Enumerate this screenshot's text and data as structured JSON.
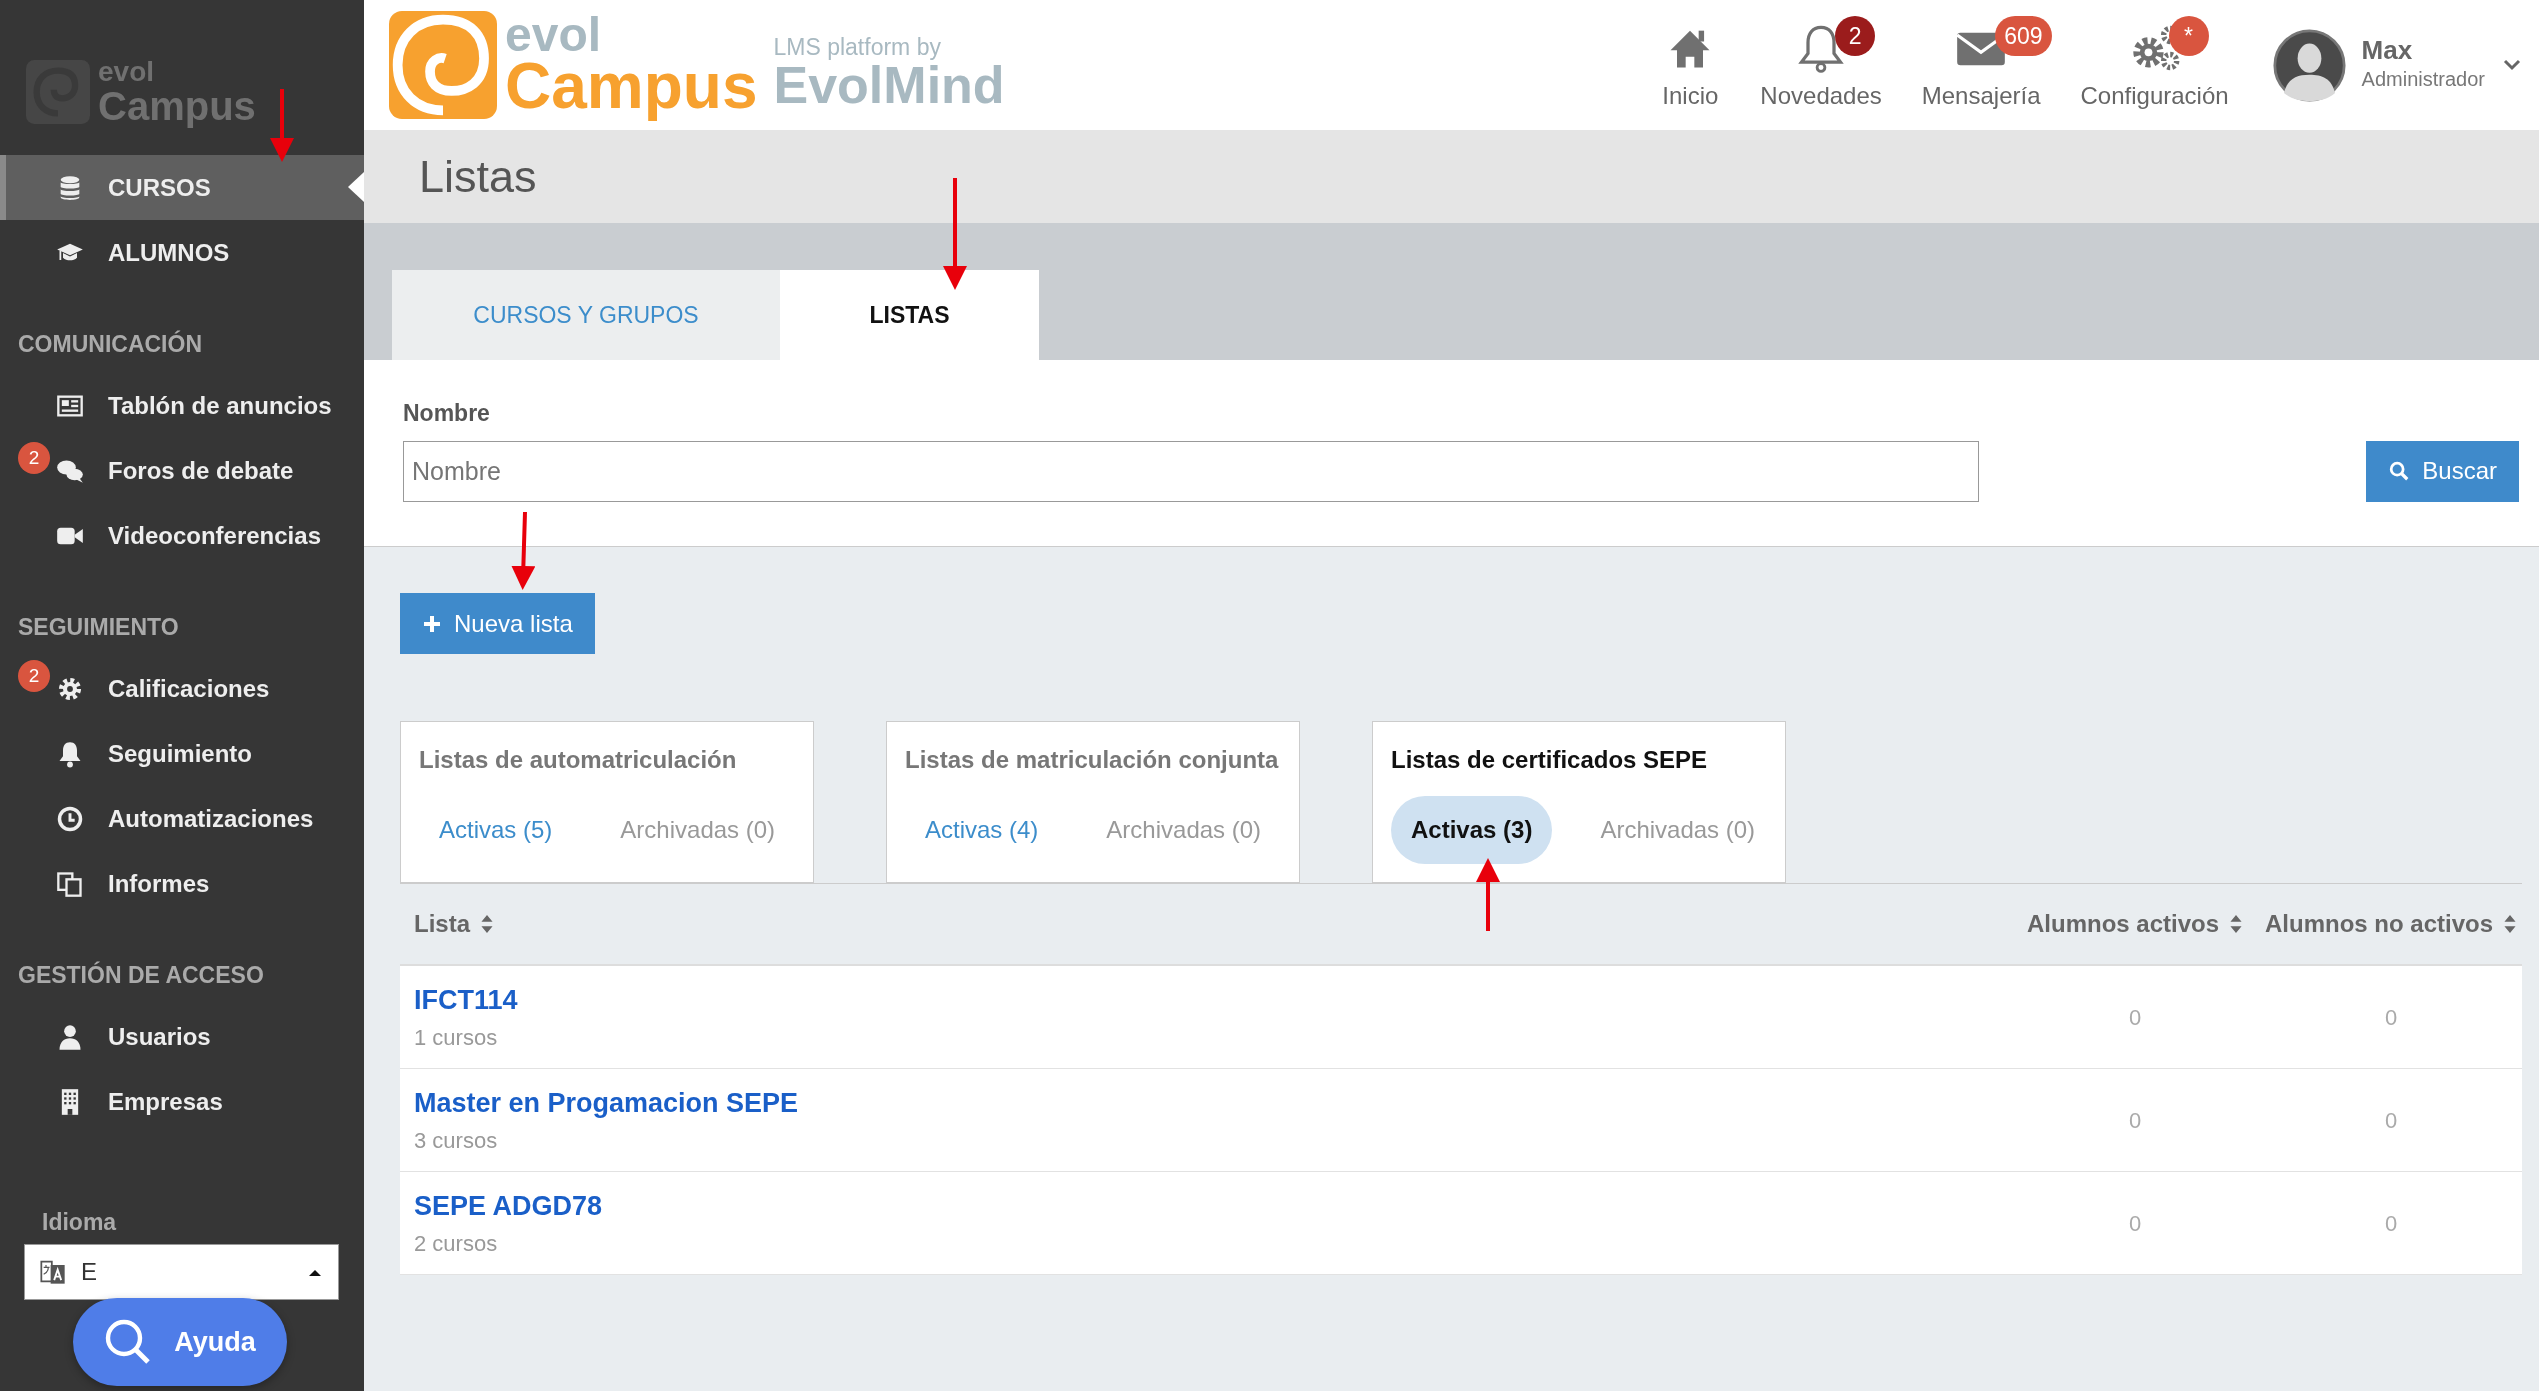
{
  "sidebar": {
    "logo": {
      "top": "evol",
      "bottom": "Campus"
    },
    "groups": [
      {
        "items": [
          {
            "label": "CURSOS",
            "selected": true
          },
          {
            "label": "ALUMNOS",
            "selected": false
          }
        ]
      },
      {
        "title": "COMUNICACIÓN",
        "items": [
          {
            "label": "Tablón de anuncios",
            "selected": false
          },
          {
            "label": "Foros de debate",
            "selected": false,
            "badge": "2"
          },
          {
            "label": "Videoconferencias",
            "selected": false
          }
        ]
      },
      {
        "title": "SEGUIMIENTO",
        "items": [
          {
            "label": "Calificaciones",
            "selected": false,
            "badge": "2"
          },
          {
            "label": "Seguimiento",
            "selected": false
          },
          {
            "label": "Automatizaciones",
            "selected": false
          },
          {
            "label": "Informes",
            "selected": false
          }
        ]
      },
      {
        "title": "GESTIÓN DE ACCESO",
        "items": [
          {
            "label": "Usuarios",
            "selected": false
          },
          {
            "label": "Empresas",
            "selected": false
          }
        ]
      }
    ],
    "language": {
      "label": "Idioma",
      "value": "E"
    },
    "help_button": "Ayuda"
  },
  "header": {
    "logo": {
      "top": "evol",
      "bottom": "Campus",
      "tagline": "LMS platform by",
      "vendor": "EvolMind"
    },
    "nav": [
      {
        "label": "Inicio"
      },
      {
        "label": "Novedades",
        "badge": {
          "text": "2",
          "color": "#9b1c1c"
        }
      },
      {
        "label": "Mensajería",
        "badge": {
          "text": "609",
          "color": "#d9553f"
        }
      },
      {
        "label": "Configuración",
        "badge": {
          "text": "*",
          "color": "#d9553f"
        }
      }
    ],
    "user": {
      "name": "Max",
      "role": "Administrador"
    }
  },
  "page_title": "Listas",
  "tabs": [
    {
      "label": "CURSOS Y GRUPOS",
      "selected": false
    },
    {
      "label": "LISTAS",
      "selected": true
    }
  ],
  "filter": {
    "label": "Nombre",
    "placeholder": "Nombre",
    "button": "Buscar"
  },
  "new_button": "Nueva lista",
  "list_types": [
    {
      "title": "Listas de automatriculación",
      "selected": false,
      "filters": [
        {
          "label": "Activas (5)",
          "selected": false,
          "disabled": false
        },
        {
          "label": "Archivadas (0)",
          "selected": false,
          "disabled": true
        }
      ]
    },
    {
      "title": "Listas de matriculación conjunta",
      "selected": false,
      "filters": [
        {
          "label": "Activas (4)",
          "selected": false,
          "disabled": false
        },
        {
          "label": "Archivadas (0)",
          "selected": false,
          "disabled": true
        }
      ]
    },
    {
      "title": "Listas de certificados SEPE",
      "selected": true,
      "filters": [
        {
          "label": "Activas (3)",
          "selected": true,
          "disabled": false
        },
        {
          "label": "Archivadas (0)",
          "selected": false,
          "disabled": true
        }
      ]
    }
  ],
  "table": {
    "columns": [
      "Lista",
      "Alumnos activos",
      "Alumnos no activos"
    ],
    "rows": [
      {
        "name": "IFCT114",
        "courses": "1 cursos",
        "active": "0",
        "inactive": "0"
      },
      {
        "name": "Master en Progamacion SEPE",
        "courses": "3 cursos",
        "active": "0",
        "inactive": "0"
      },
      {
        "name": "SEPE ADGD78",
        "courses": "2 cursos",
        "active": "0",
        "inactive": "0"
      }
    ]
  }
}
